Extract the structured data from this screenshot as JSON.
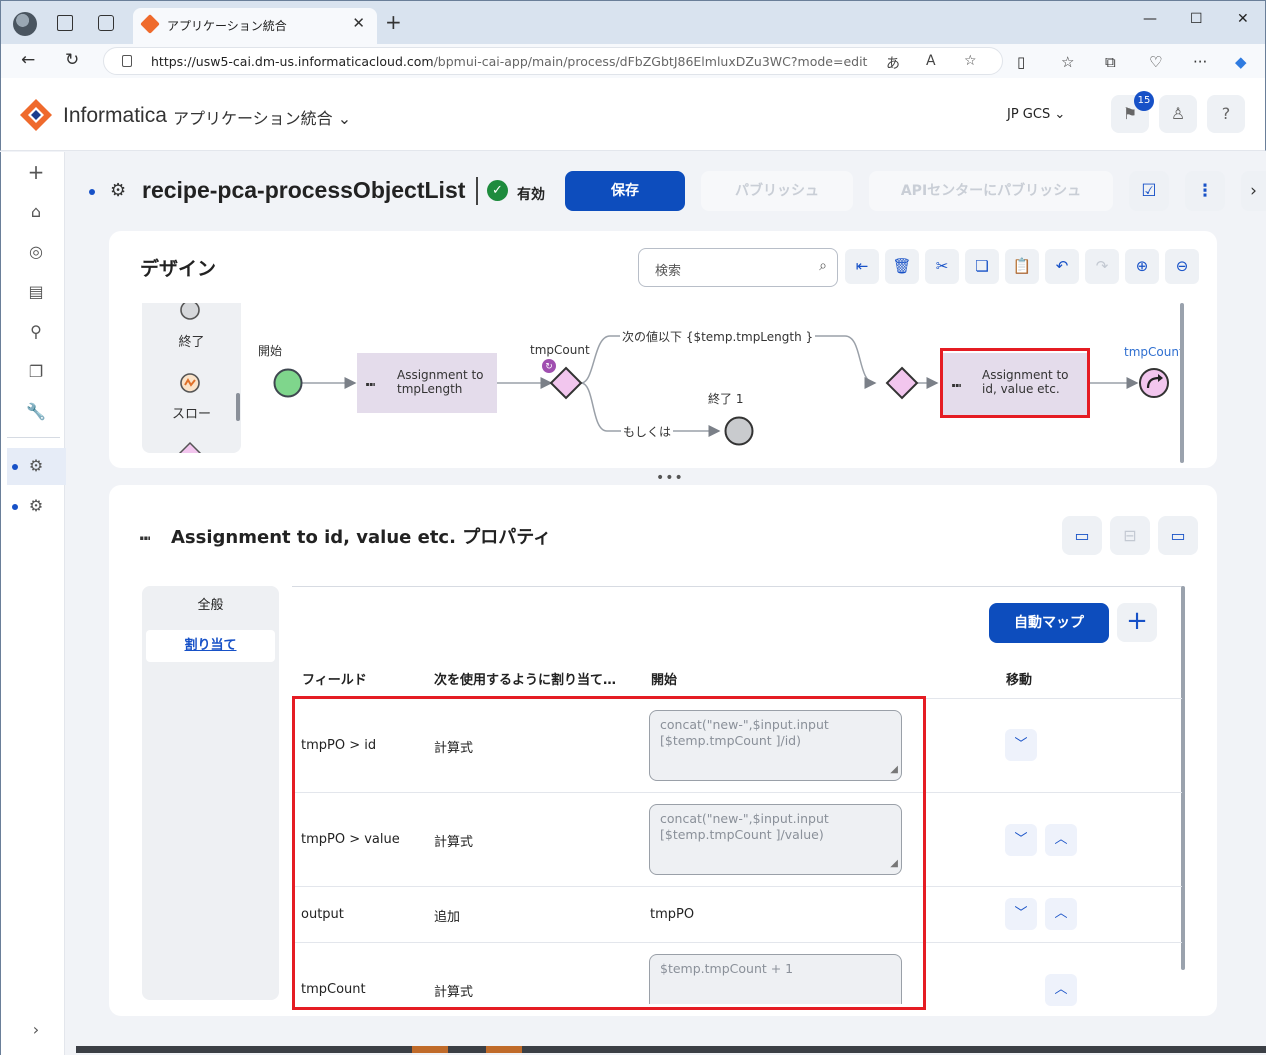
{
  "browser": {
    "tab_title": "アプリケーション統合",
    "url_host": "https://usw5-cai.dm-us.informaticacloud.com",
    "url_path": "/bpmui-cai-app/main/process/dFbZGbtJ86ElmluxDZu3WC?mode=edit"
  },
  "header": {
    "brand": "Informatica",
    "app_name": "アプリケーション統合",
    "org": "JP GCS",
    "notification_count": "15"
  },
  "process": {
    "name": "recipe-pca-processObjectList",
    "status": "有効",
    "save_label": "保存",
    "publish_label": "パブリッシュ",
    "api_publish_label": "APIセンターにパブリッシュ"
  },
  "design": {
    "title": "デザイン",
    "search_placeholder": "検索",
    "palette": {
      "end": "終了",
      "throw": "スロー"
    },
    "labels": {
      "start": "開始",
      "assign1_l1": "Assignment to",
      "assign1_l2": "tmpLength",
      "tmpcount1": "tmpCount",
      "next_condition": "次の値以下 {$temp.tmpLength }",
      "otherwise": "もしくは",
      "end1": "終了 1",
      "assign2_l1": "Assignment to",
      "assign2_l2": "id, value etc.",
      "tmpcount2": "tmpCount"
    }
  },
  "properties": {
    "title": "Assignment to id, value etc. プロパティ",
    "tabs": [
      "全般",
      "割り当て"
    ],
    "auto_map_label": "自動マップ",
    "columns": {
      "field": "フィールド",
      "assign_using": "次を使用するように割り当て…",
      "start": "開始",
      "move": "移動"
    },
    "rows": [
      {
        "field": "tmpPO > id",
        "method": "計算式",
        "value": "concat(\"new-\",$input.input\n[$temp.tmpCount ]/id)"
      },
      {
        "field": "tmpPO > value",
        "method": "計算式",
        "value": "concat(\"new-\",$input.input\n[$temp.tmpCount ]/value)"
      },
      {
        "field": "output",
        "method": "追加",
        "value": "tmpPO"
      },
      {
        "field": "tmpCount",
        "method": "計算式",
        "value": "$temp.tmpCount + 1"
      }
    ]
  },
  "colors": {
    "accent": "#0d4dbd",
    "highlight": "#e51c23",
    "node_fill": "#e4dceb",
    "gateway": "#f2c6ee",
    "start_node": "#7fd68c"
  }
}
